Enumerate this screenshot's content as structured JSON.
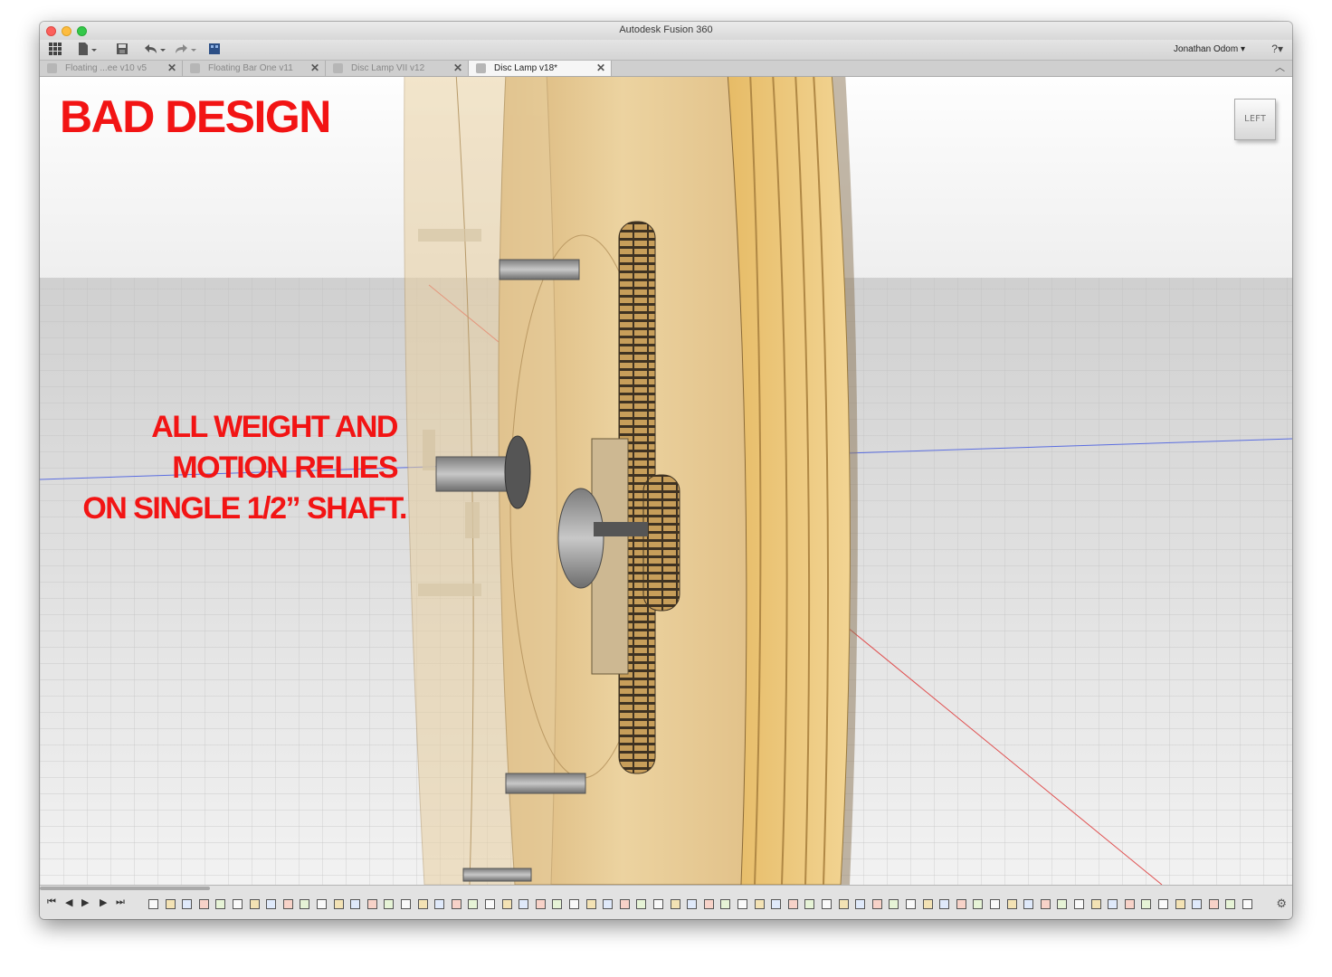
{
  "window": {
    "title": "Autodesk Fusion 360"
  },
  "toolbar": {
    "grid_icon": "grid-menu-icon",
    "file_icon": "file-icon",
    "save_icon": "save-icon",
    "undo_icon": "undo-icon",
    "redo_icon": "redo-icon",
    "user": "Jonathan Odom ▾",
    "help": "?▾"
  },
  "tabs": [
    {
      "label": "Floating ...ee v10 v5",
      "active": false
    },
    {
      "label": "Floating Bar One v11",
      "active": false
    },
    {
      "label": "Disc Lamp VII v12",
      "active": false
    },
    {
      "label": "Disc Lamp v18*",
      "active": true
    }
  ],
  "overlay": {
    "headline": "BAD DESIGN",
    "note_lines": [
      "ALL WEIGHT AND",
      "MOTION RELIES",
      "ON SINGLE 1/2” SHAFT."
    ],
    "color": "#f21414"
  },
  "viewcube": {
    "label": "LEFT"
  },
  "colors": {
    "wood_light": "#e9c98a",
    "wood_dark": "#d4a95e",
    "ground": "#e8e8e8",
    "axis_red": "#e05050",
    "axis_blue": "#5a6de0"
  },
  "timeline": {
    "playback_icons": [
      "skip-start-icon",
      "step-back-icon",
      "play-icon",
      "step-forward-icon",
      "skip-end-icon"
    ],
    "settings_icon": "settings-gear-icon"
  }
}
